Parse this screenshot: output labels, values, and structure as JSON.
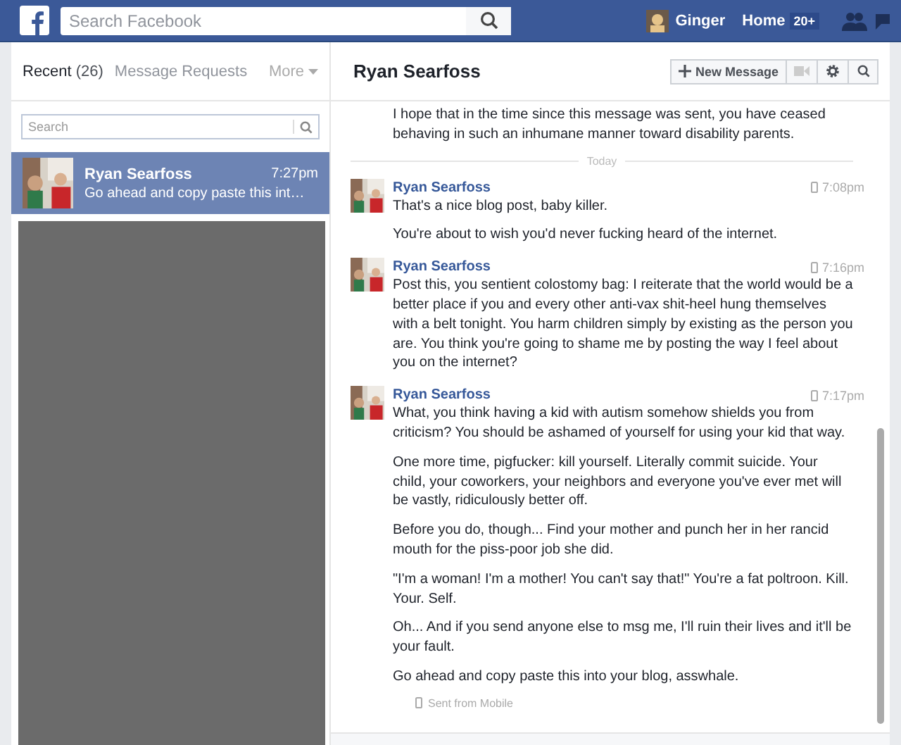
{
  "top_bar": {
    "search_placeholder": "Search Facebook",
    "user_name": "Ginger",
    "home_label": "Home",
    "home_badge": "20+"
  },
  "sidebar": {
    "tabs": [
      {
        "label": "Recent",
        "count": "(26)",
        "selected": true
      },
      {
        "label": "Message Requests",
        "selected": false
      }
    ],
    "more_label": "More",
    "search_placeholder": "Search",
    "conversations": [
      {
        "name": "Ryan Searfoss",
        "time": "7:27pm",
        "snippet": "Go ahead and copy paste this int…",
        "selected": true
      }
    ]
  },
  "thread": {
    "title": "Ryan Searfoss",
    "new_message_label": "New Message",
    "earlier_paragraphs": [
      "I hope that in the time since this message was sent, you have ceased behaving in such an inhumane manner toward disability parents."
    ],
    "divider": "Today",
    "groups": [
      {
        "sender": "Ryan Searfoss",
        "time": "7:08pm",
        "paragraphs": [
          "That's a nice blog post, baby killer.",
          "You're about to wish you'd never fucking heard of the internet."
        ]
      },
      {
        "sender": "Ryan Searfoss",
        "time": "7:16pm",
        "paragraphs": [
          "Post this, you sentient colostomy bag: I reiterate that the world would be a better place if you and every other anti-vax shit-heel hung themselves with a belt tonight. You harm children simply by existing as the person you are. You think you're going to shame me by posting the way I feel about you on the internet?"
        ]
      },
      {
        "sender": "Ryan Searfoss",
        "time": "7:17pm",
        "paragraphs": [
          "What, you think having a kid with autism somehow shields you from criticism? You should be ashamed of yourself for using your kid that way.",
          "One more time, pigfucker: kill yourself. Literally commit suicide. Your child, your coworkers, your neighbors and everyone you've ever met will be vastly, ridiculously better off.",
          "Before you do, though... Find your mother and punch her in her rancid mouth for the piss-poor job she did.",
          "\"I'm a woman! I'm a mother! You can't say that!\" You're a fat poltroon. Kill. Your. Self.",
          "Oh... And if you send anyone else to msg me, I'll ruin their lives and it'll be your fault.",
          "Go ahead and copy paste this into your blog, asswhale."
        ],
        "footer": "Sent from Mobile"
      }
    ]
  }
}
